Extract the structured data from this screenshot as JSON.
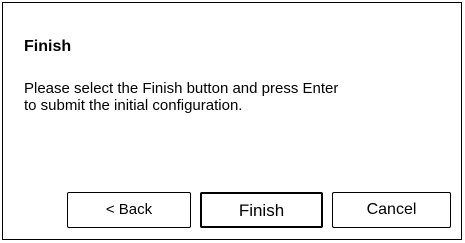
{
  "dialog": {
    "title": "Finish",
    "message": "Please select the Finish button and press Enter to submit the initial configuration.",
    "buttons": {
      "back": "< Back",
      "finish": "Finish",
      "cancel": "Cancel"
    },
    "default_button": "finish"
  }
}
